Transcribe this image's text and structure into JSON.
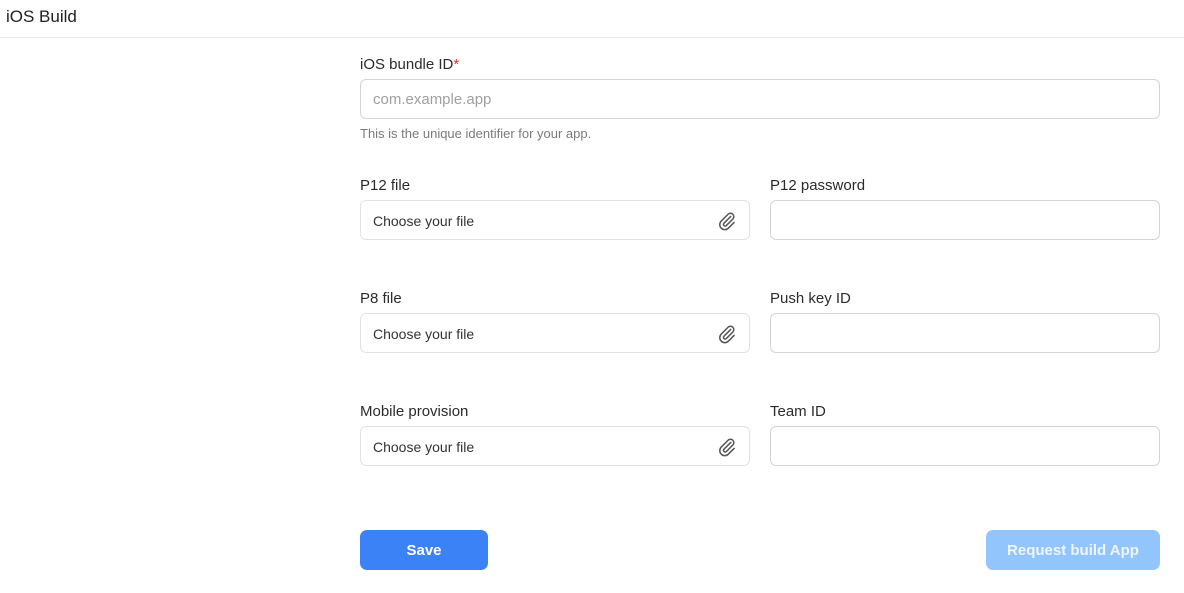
{
  "header": {
    "title": "iOS Build"
  },
  "form": {
    "bundle_id": {
      "label": "iOS bundle ID",
      "required_marker": "*",
      "placeholder": "com.example.app",
      "value": "",
      "hint": "This is the unique identifier for your app."
    },
    "p12_file": {
      "label": "P12 file",
      "placeholder": "Choose your file",
      "icon": "paperclip-icon"
    },
    "p12_password": {
      "label": "P12 password",
      "value": ""
    },
    "p8_file": {
      "label": "P8 file",
      "placeholder": "Choose your file",
      "icon": "paperclip-icon"
    },
    "push_key_id": {
      "label": "Push key ID",
      "value": ""
    },
    "mobile_provision": {
      "label": "Mobile provision",
      "placeholder": "Choose your file",
      "icon": "paperclip-icon"
    },
    "team_id": {
      "label": "Team ID",
      "value": ""
    }
  },
  "actions": {
    "save_label": "Save",
    "request_build_label": "Request build App",
    "request_build_disabled": true
  },
  "colors": {
    "primary": "#3b82f6",
    "primary_disabled": "#93c5fd",
    "required": "#e03131"
  }
}
